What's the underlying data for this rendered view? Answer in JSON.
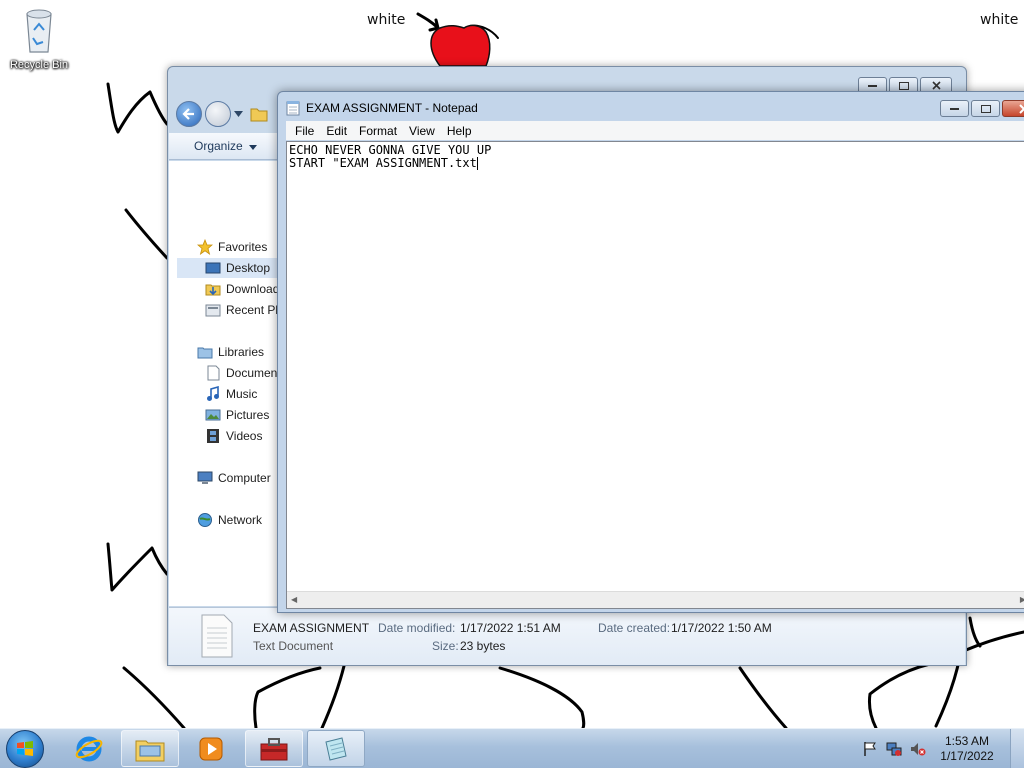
{
  "desktop": {
    "wallpaper_words": [
      "white",
      "white"
    ],
    "icons": [
      {
        "label": "Recycle Bin",
        "icon": "recycle-bin-icon"
      }
    ]
  },
  "explorer": {
    "toolbar": {
      "organize": "Organize"
    },
    "nav": {
      "favorites": "Favorites",
      "desktop": "Desktop",
      "downloads": "Downloads",
      "recent": "Recent Places",
      "libraries": "Libraries",
      "documents": "Documents",
      "music": "Music",
      "pictures": "Pictures",
      "videos": "Videos",
      "computer": "Computer",
      "network": "Network"
    },
    "details": {
      "name": "EXAM ASSIGNMENT",
      "type": "Text Document",
      "modified_label": "Date modified:",
      "modified_value": "1/17/2022 1:51 AM",
      "created_label": "Date created:",
      "created_value": "1/17/2022 1:50 AM",
      "size_label": "Size:",
      "size_value": "23 bytes"
    }
  },
  "notepad": {
    "title": "EXAM ASSIGNMENT - Notepad",
    "menu": [
      "File",
      "Edit",
      "Format",
      "View",
      "Help"
    ],
    "lines": [
      "ECHO NEVER GONNA GIVE YOU UP",
      "START \"EXAM ASSIGNMENT.txt"
    ]
  },
  "taskbar": {
    "clock_time": "1:53 AM",
    "clock_date": "1/17/2022"
  },
  "colors": {
    "accent": "#2a66b8",
    "taskbar": "#a7c0dc",
    "close_button": "#c6452c",
    "apple_red": "#e8101a"
  }
}
